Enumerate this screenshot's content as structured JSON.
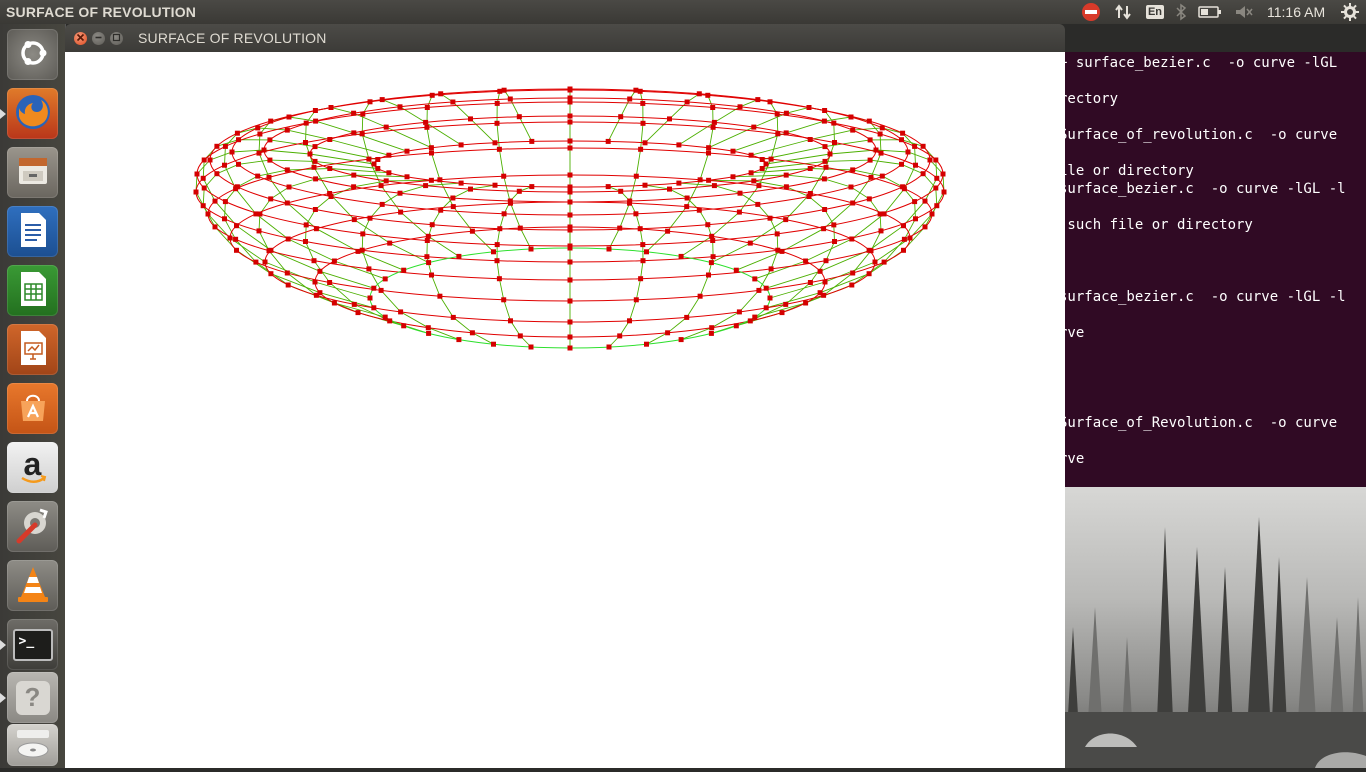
{
  "top_panel": {
    "app_title": "SURFACE OF REVOLUTION",
    "keyboard_layout": "En",
    "clock": "11:16 AM",
    "icons": [
      "no-entry-icon",
      "network-transfer-icon",
      "keyboard-layout-indicator",
      "bluetooth-icon",
      "battery-icon",
      "volume-muted-icon",
      "power-gear-icon"
    ]
  },
  "launcher": {
    "items": [
      {
        "name": "ubuntu-dash",
        "icon": "ubuntu-logo-icon"
      },
      {
        "name": "firefox",
        "icon": "firefox-icon"
      },
      {
        "name": "files",
        "icon": "file-cabinet-icon"
      },
      {
        "name": "libreoffice-writer",
        "icon": "writer-document-icon"
      },
      {
        "name": "libreoffice-calc",
        "icon": "calc-spreadsheet-icon"
      },
      {
        "name": "libreoffice-impress",
        "icon": "impress-presentation-icon"
      },
      {
        "name": "ubuntu-software-center",
        "icon": "software-center-bag-icon"
      },
      {
        "name": "amazon",
        "icon": "amazon-logo-icon"
      },
      {
        "name": "system-settings",
        "icon": "settings-wrench-gear-icon"
      },
      {
        "name": "vlc",
        "icon": "vlc-cone-icon"
      },
      {
        "name": "terminal",
        "icon": "terminal-prompt-icon"
      },
      {
        "name": "unknown-app",
        "icon": "question-mark-icon"
      },
      {
        "name": "optical-drive",
        "icon": "cd-drive-icon"
      }
    ],
    "terminal_prompt_glyph": ">_",
    "unknown_glyph": "?",
    "amazon_glyph": "a"
  },
  "window": {
    "title": "SURFACE OF REVOLUTION",
    "controls": [
      "close",
      "minimize",
      "maximize"
    ],
    "mesh_colors": {
      "rings": "#e00000",
      "vertices": "#d40000",
      "meridians": "#4caf00",
      "base_ring": "#2ee02e"
    }
  },
  "terminal": {
    "background": "#300a24",
    "lines": [
      "+ surface_bezier.c  -o curve -lGL",
      "rectory",
      "Surface_of_revolution.c  -o curve",
      "ile or directory",
      "surface_bezier.c  -o curve -lGL -l",
      " such file or directory",
      "surface_bezier.c  -o curve -lGL -l",
      "rve",
      "Surface_of_Revolution.c  -o curve",
      "rve"
    ]
  }
}
